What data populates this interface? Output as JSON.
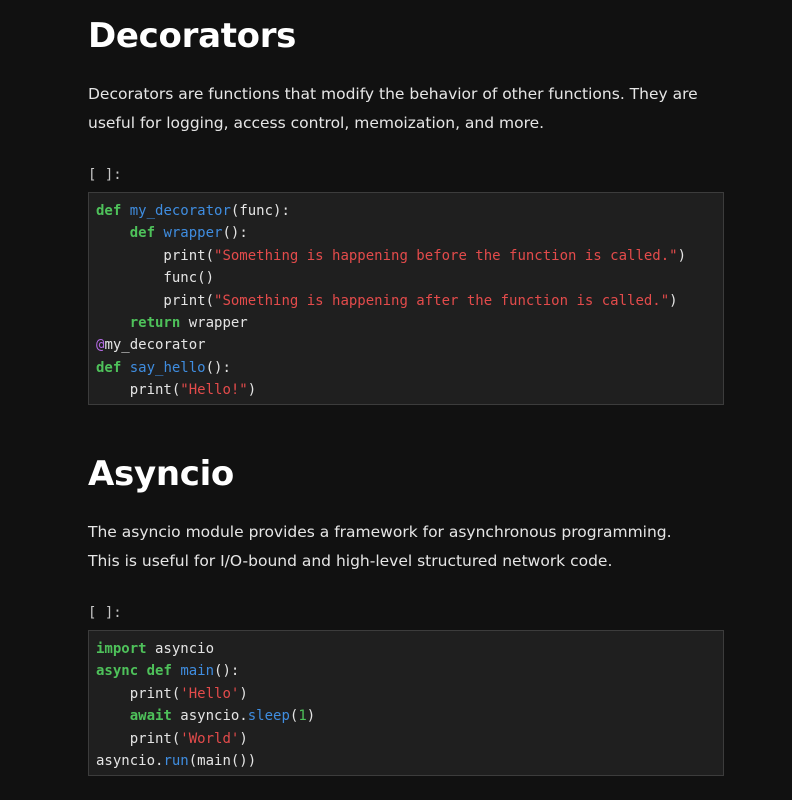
{
  "sections": [
    {
      "title": "Decorators",
      "body": "Decorators are functions that modify the behavior of other functions. They are useful for logging, access control, memoization, and more.",
      "prompt": "[ ]:",
      "code": [
        [
          [
            "kw",
            "def"
          ],
          [
            "plain",
            " "
          ],
          [
            "fn",
            "my_decorator"
          ],
          [
            "plain",
            "(func):"
          ]
        ],
        [
          [
            "plain",
            "    "
          ],
          [
            "kw",
            "def"
          ],
          [
            "plain",
            " "
          ],
          [
            "fn",
            "wrapper"
          ],
          [
            "plain",
            "():"
          ]
        ],
        [
          [
            "plain",
            "        print("
          ],
          [
            "str",
            "\"Something is happening before the function is called.\""
          ],
          [
            "plain",
            ")"
          ]
        ],
        [
          [
            "plain",
            "        func()"
          ]
        ],
        [
          [
            "plain",
            "        print("
          ],
          [
            "str",
            "\"Something is happening after the function is called.\""
          ],
          [
            "plain",
            ")"
          ]
        ],
        [
          [
            "plain",
            "    "
          ],
          [
            "kw",
            "return"
          ],
          [
            "plain",
            " wrapper"
          ]
        ],
        [
          [
            "dec",
            "@"
          ],
          [
            "plain",
            "my_decorator"
          ]
        ],
        [
          [
            "kw",
            "def"
          ],
          [
            "plain",
            " "
          ],
          [
            "fn",
            "say_hello"
          ],
          [
            "plain",
            "():"
          ]
        ],
        [
          [
            "plain",
            "    print("
          ],
          [
            "str",
            "\"Hello!\""
          ],
          [
            "plain",
            ")"
          ]
        ]
      ]
    },
    {
      "title": "Asyncio",
      "body": "The asyncio module provides a framework for asynchronous programming. This is useful for I/O-bound and high-level structured network code.",
      "prompt": "[ ]:",
      "code": [
        [
          [
            "kw",
            "import"
          ],
          [
            "plain",
            " asyncio"
          ]
        ],
        [
          [
            "kw",
            "async"
          ],
          [
            "plain",
            " "
          ],
          [
            "kw",
            "def"
          ],
          [
            "plain",
            " "
          ],
          [
            "fn",
            "main"
          ],
          [
            "plain",
            "():"
          ]
        ],
        [
          [
            "plain",
            "    print("
          ],
          [
            "str",
            "'Hello'"
          ],
          [
            "plain",
            ")"
          ]
        ],
        [
          [
            "plain",
            "    "
          ],
          [
            "kw",
            "await"
          ],
          [
            "plain",
            " asyncio."
          ],
          [
            "fn",
            "sleep"
          ],
          [
            "plain",
            "("
          ],
          [
            "num",
            "1"
          ],
          [
            "plain",
            ")"
          ]
        ],
        [
          [
            "plain",
            "    print("
          ],
          [
            "str",
            "'World'"
          ],
          [
            "plain",
            ")"
          ]
        ],
        [
          [
            "plain",
            "asyncio."
          ],
          [
            "fn",
            "run"
          ],
          [
            "plain",
            "(main())"
          ]
        ]
      ]
    }
  ]
}
